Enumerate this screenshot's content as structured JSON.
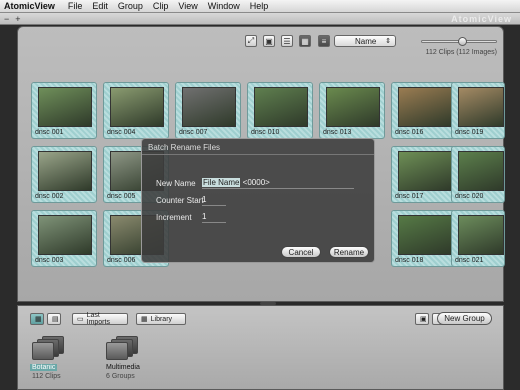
{
  "menubar": {
    "app": "AtomicView",
    "items": [
      "File",
      "Edit",
      "Group",
      "Clip",
      "View",
      "Window",
      "Help"
    ]
  },
  "brand": "AtomicView",
  "toolbar": {
    "sort_value": "Name",
    "clip_count": "112 Clips (112 Images)",
    "zoom_level": 0.55
  },
  "thumbnails": [
    {
      "caption": "dnsc 001",
      "color": "#6f8f5a"
    },
    {
      "caption": "dnsc 004",
      "color": "#8a9b70"
    },
    {
      "caption": "dnsc 007",
      "color": "#707070"
    },
    {
      "caption": "dnsc 010",
      "color": "#5f7f4f"
    },
    {
      "caption": "dnsc 013",
      "color": "#6a8a4e"
    },
    {
      "caption": "dnsc 016",
      "color": "#9a7c52"
    },
    {
      "caption": "dnsc 019",
      "color": "#a48a64"
    },
    {
      "caption": "dnsc 002",
      "color": "#9aa58a"
    },
    {
      "caption": "dnsc 005",
      "color": "#8e9786"
    },
    {
      "caption": "dnsc 017",
      "color": "#6e8f56"
    },
    {
      "caption": "dnsc 020",
      "color": "#5c7f4c"
    },
    {
      "caption": "dnsc 003",
      "color": "#7f9378"
    },
    {
      "caption": "dnsc 006",
      "color": "#8a8a6e"
    },
    {
      "caption": "dnsc 018",
      "color": "#567a46"
    },
    {
      "caption": "dnsc 021",
      "color": "#6c8c5c"
    }
  ],
  "dialog": {
    "title": "Batch Rename Files",
    "new_name_label": "New Name",
    "new_name_highlight": "File Name",
    "new_name_rest": " <0000>",
    "counter_label": "Counter Start",
    "counter_value": "1",
    "increment_label": "Increment",
    "increment_value": "1",
    "cancel": "Cancel",
    "rename": "Rename"
  },
  "bottom": {
    "last_imports": "Last Imports",
    "library": "Library",
    "new_group": "New Group",
    "groups": [
      {
        "name": "Botanic",
        "sub": "112 Clips"
      },
      {
        "name": "Multimedia",
        "sub": "6 Groups"
      }
    ]
  }
}
